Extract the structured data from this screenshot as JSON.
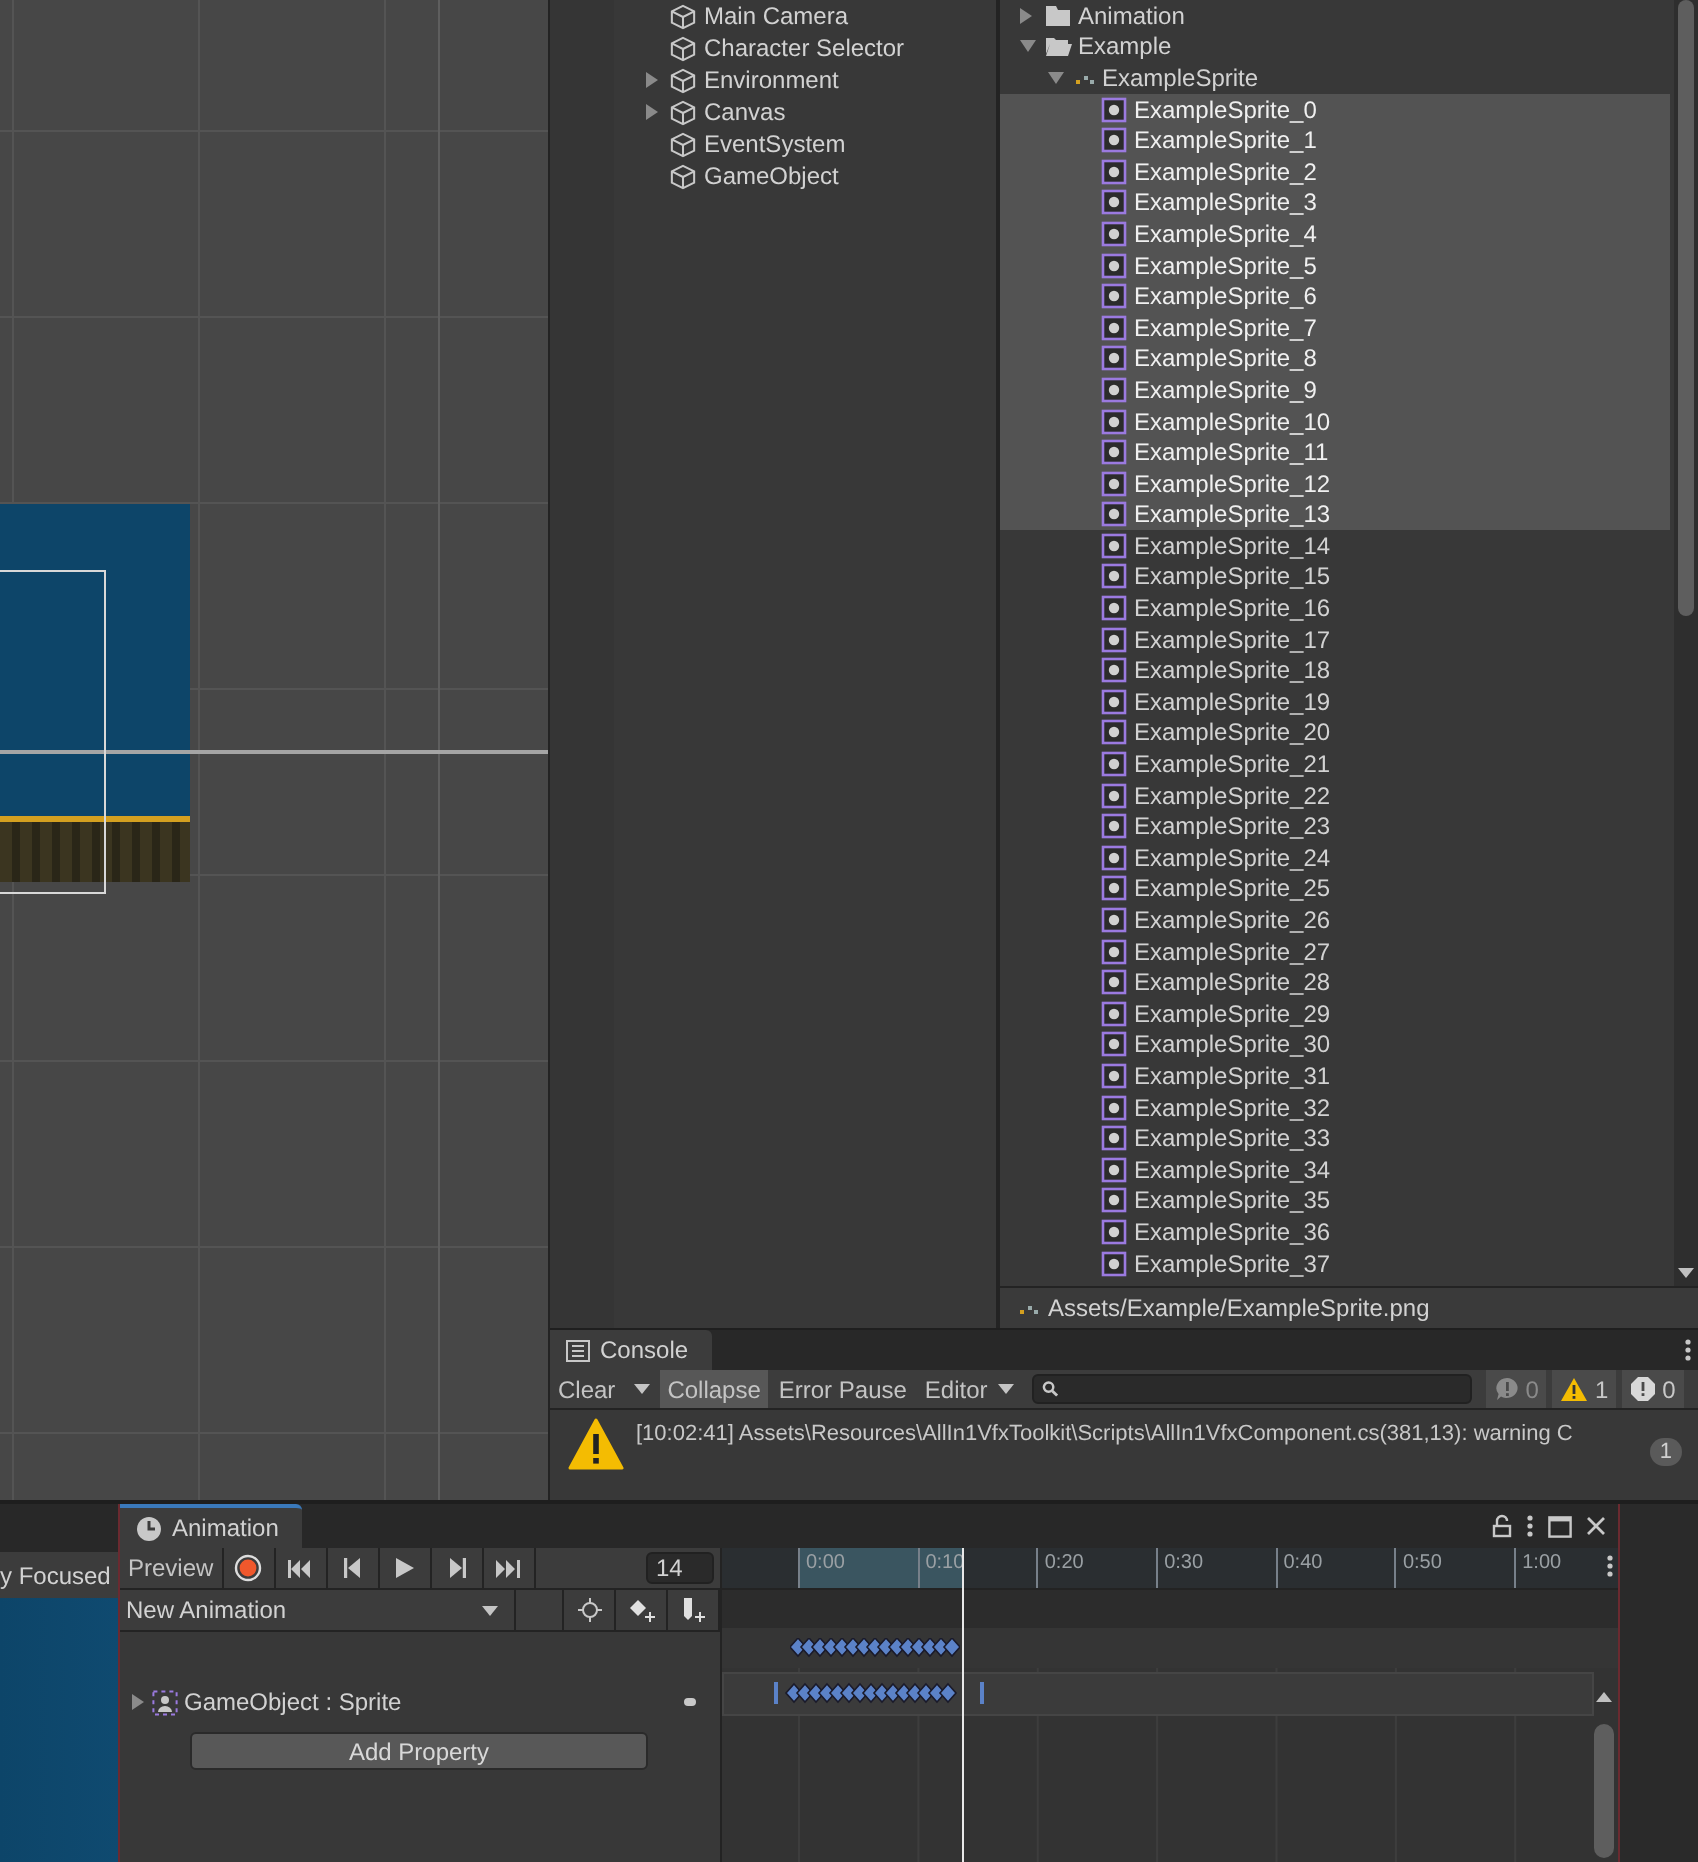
{
  "scene": {
    "tab_label": "y Focused"
  },
  "hierarchy": {
    "items": [
      {
        "label": "Main Camera",
        "expandable": false
      },
      {
        "label": "Character Selector",
        "expandable": false
      },
      {
        "label": "Environment",
        "expandable": true
      },
      {
        "label": "Canvas",
        "expandable": true
      },
      {
        "label": "EventSystem",
        "expandable": false
      },
      {
        "label": "GameObject",
        "expandable": false
      }
    ]
  },
  "project": {
    "tree": [
      {
        "label": "Animation",
        "kind": "folder",
        "expanded": false,
        "selected": false
      },
      {
        "label": "Example",
        "kind": "folder",
        "expanded": true,
        "selected": false,
        "children": [
          {
            "label": "ExampleSprite",
            "kind": "texture",
            "expanded": true,
            "selected": false,
            "children": [
              {
                "label": "ExampleSprite_0",
                "kind": "sprite",
                "selected": true
              },
              {
                "label": "ExampleSprite_1",
                "kind": "sprite",
                "selected": true
              },
              {
                "label": "ExampleSprite_2",
                "kind": "sprite",
                "selected": true
              },
              {
                "label": "ExampleSprite_3",
                "kind": "sprite",
                "selected": true
              },
              {
                "label": "ExampleSprite_4",
                "kind": "sprite",
                "selected": true
              },
              {
                "label": "ExampleSprite_5",
                "kind": "sprite",
                "selected": true
              },
              {
                "label": "ExampleSprite_6",
                "kind": "sprite",
                "selected": true
              },
              {
                "label": "ExampleSprite_7",
                "kind": "sprite",
                "selected": true
              },
              {
                "label": "ExampleSprite_8",
                "kind": "sprite",
                "selected": true
              },
              {
                "label": "ExampleSprite_9",
                "kind": "sprite",
                "selected": true
              },
              {
                "label": "ExampleSprite_10",
                "kind": "sprite",
                "selected": true
              },
              {
                "label": "ExampleSprite_11",
                "kind": "sprite",
                "selected": true
              },
              {
                "label": "ExampleSprite_12",
                "kind": "sprite",
                "selected": true
              },
              {
                "label": "ExampleSprite_13",
                "kind": "sprite",
                "selected": true
              },
              {
                "label": "ExampleSprite_14",
                "kind": "sprite",
                "selected": false
              },
              {
                "label": "ExampleSprite_15",
                "kind": "sprite",
                "selected": false
              },
              {
                "label": "ExampleSprite_16",
                "kind": "sprite",
                "selected": false
              },
              {
                "label": "ExampleSprite_17",
                "kind": "sprite",
                "selected": false
              },
              {
                "label": "ExampleSprite_18",
                "kind": "sprite",
                "selected": false
              },
              {
                "label": "ExampleSprite_19",
                "kind": "sprite",
                "selected": false
              },
              {
                "label": "ExampleSprite_20",
                "kind": "sprite",
                "selected": false
              },
              {
                "label": "ExampleSprite_21",
                "kind": "sprite",
                "selected": false
              },
              {
                "label": "ExampleSprite_22",
                "kind": "sprite",
                "selected": false
              },
              {
                "label": "ExampleSprite_23",
                "kind": "sprite",
                "selected": false
              },
              {
                "label": "ExampleSprite_24",
                "kind": "sprite",
                "selected": false
              },
              {
                "label": "ExampleSprite_25",
                "kind": "sprite",
                "selected": false
              },
              {
                "label": "ExampleSprite_26",
                "kind": "sprite",
                "selected": false
              },
              {
                "label": "ExampleSprite_27",
                "kind": "sprite",
                "selected": false
              },
              {
                "label": "ExampleSprite_28",
                "kind": "sprite",
                "selected": false
              },
              {
                "label": "ExampleSprite_29",
                "kind": "sprite",
                "selected": false
              },
              {
                "label": "ExampleSprite_30",
                "kind": "sprite",
                "selected": false
              },
              {
                "label": "ExampleSprite_31",
                "kind": "sprite",
                "selected": false
              },
              {
                "label": "ExampleSprite_32",
                "kind": "sprite",
                "selected": false
              },
              {
                "label": "ExampleSprite_33",
                "kind": "sprite",
                "selected": false
              },
              {
                "label": "ExampleSprite_34",
                "kind": "sprite",
                "selected": false
              },
              {
                "label": "ExampleSprite_35",
                "kind": "sprite",
                "selected": false
              },
              {
                "label": "ExampleSprite_36",
                "kind": "sprite",
                "selected": false
              },
              {
                "label": "ExampleSprite_37",
                "kind": "sprite",
                "selected": false
              }
            ]
          }
        ]
      }
    ],
    "path": "Assets/Example/ExampleSprite.png"
  },
  "console": {
    "tab": "Console",
    "buttons": [
      {
        "label": "Clear",
        "kind": "split",
        "on": false
      },
      {
        "label": "Collapse",
        "kind": "toggle",
        "on": true
      },
      {
        "label": "Error Pause",
        "kind": "toggle",
        "on": false
      },
      {
        "label": "Editor",
        "kind": "dropdown",
        "on": false
      }
    ],
    "counters": [
      {
        "kind": "info",
        "count": "0"
      },
      {
        "kind": "warning",
        "count": "1"
      },
      {
        "kind": "error",
        "count": "0"
      }
    ],
    "messages": [
      {
        "kind": "warning",
        "text": "[10:02:41] Assets\\Resources\\AllIn1VfxToolkit\\Scripts\\AllIn1VfxComponent.cs(381,13): warning C",
        "count": "1"
      }
    ]
  },
  "animation": {
    "tab": "Animation",
    "preview": {
      "label": "Preview",
      "on": false
    },
    "frame": "14",
    "clip": "New Animation",
    "ruler": [
      "0:00",
      "0:10",
      "0:20",
      "0:30",
      "0:40",
      "0:50",
      "1:00"
    ],
    "properties": [
      {
        "label": "GameObject : Sprite",
        "expanded": false
      }
    ],
    "add_property": "Add Property"
  }
}
